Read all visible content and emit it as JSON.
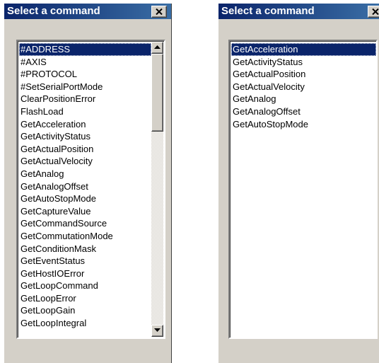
{
  "windows": [
    {
      "title": "Select a command",
      "items": [
        "#ADDRESS",
        "#AXIS",
        "#PROTOCOL",
        "#SetSerialPortMode",
        "ClearPositionError",
        "FlashLoad",
        "GetAcceleration",
        "GetActivityStatus",
        "GetActualPosition",
        "GetActualVelocity",
        "GetAnalog",
        "GetAnalogOffset",
        "GetAutoStopMode",
        "GetCaptureValue",
        "GetCommandSource",
        "GetCommutationMode",
        "GetConditionMask",
        "GetEventStatus",
        "GetHostIOError",
        "GetLoopCommand",
        "GetLoopError",
        "GetLoopGain",
        "GetLoopIntegral"
      ],
      "selected": "#ADDRESS",
      "has_scrollbar": true
    },
    {
      "title": "Select a command",
      "items": [
        "GetAcceleration",
        "GetActivityStatus",
        "GetActualPosition",
        "GetActualVelocity",
        "GetAnalog",
        "GetAnalogOffset",
        "GetAutoStopMode"
      ],
      "selected": "GetAcceleration",
      "has_scrollbar": false
    }
  ],
  "icons": {
    "close": "close-x-icon",
    "scroll_up": "arrow-up-icon",
    "scroll_down": "arrow-down-icon"
  },
  "colors": {
    "titlebar_start": "#0a246a",
    "titlebar_end": "#3a6ea5",
    "selection": "#0a246a",
    "face": "#d4d0c8"
  }
}
